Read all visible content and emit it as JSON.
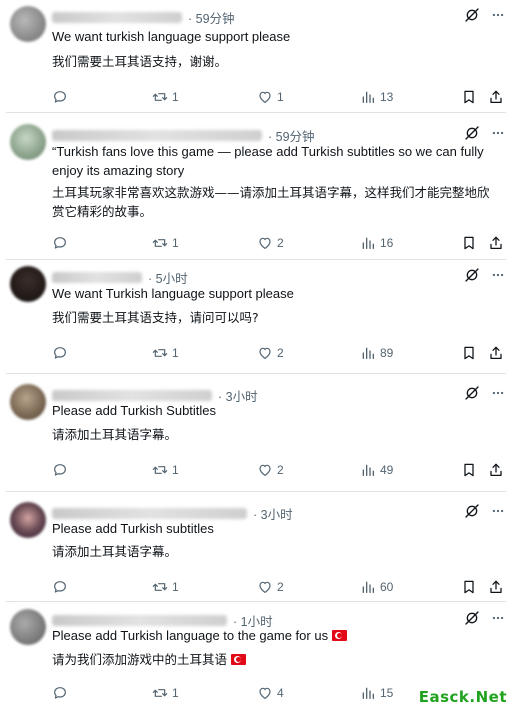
{
  "tweets": [
    {
      "time": "· 59分钟",
      "text": "We want turkish language support please",
      "translation": "我们需要土耳其语支持，谢谢。",
      "reply_count": "",
      "retweet_count": "1",
      "like_count": "1",
      "view_count": "13"
    },
    {
      "time": "· 59分钟",
      "text": "“Turkish fans love this game — please add Turkish subtitles so we can fully enjoy its amazing story",
      "translation": "土耳其玩家非常喜欢这款游戏——请添加土耳其语字幕，这样我们才能完整地欣赏它精彩的故事。",
      "reply_count": "",
      "retweet_count": "1",
      "like_count": "2",
      "view_count": "16"
    },
    {
      "time": "· 5小时",
      "text": "We want Turkish language support please",
      "translation": "我们需要土耳其语支持，请问可以吗?",
      "reply_count": "",
      "retweet_count": "1",
      "like_count": "2",
      "view_count": "89"
    },
    {
      "time": "· 3小时",
      "text": "Please add Turkish Subtitles",
      "translation": "请添加土耳其语字幕。",
      "reply_count": "",
      "retweet_count": "1",
      "like_count": "2",
      "view_count": "49"
    },
    {
      "time": "· 3小时",
      "text": "Please add Turkish subtitles",
      "translation": "请添加土耳其语字幕。",
      "reply_count": "",
      "retweet_count": "1",
      "like_count": "2",
      "view_count": "60"
    },
    {
      "time": "· 1小时",
      "text": "Please add Turkish language to the game for us",
      "translation": "请为我们添加游戏中的土耳其语",
      "reply_count": "",
      "retweet_count": "1",
      "like_count": "4",
      "view_count": "15"
    }
  ],
  "icons": {
    "reply": "reply-icon",
    "retweet": "retweet-icon",
    "like": "heart-icon",
    "views": "views-chart-icon",
    "bookmark": "bookmark-icon",
    "share": "share-icon",
    "grok": "grok-icon",
    "more": "more-icon",
    "flag": "turkey-flag-icon"
  },
  "colors": {
    "text": "#0f1419",
    "secondary": "#536471",
    "watermark": "#1fa31f"
  },
  "watermark": "Easck.Net"
}
